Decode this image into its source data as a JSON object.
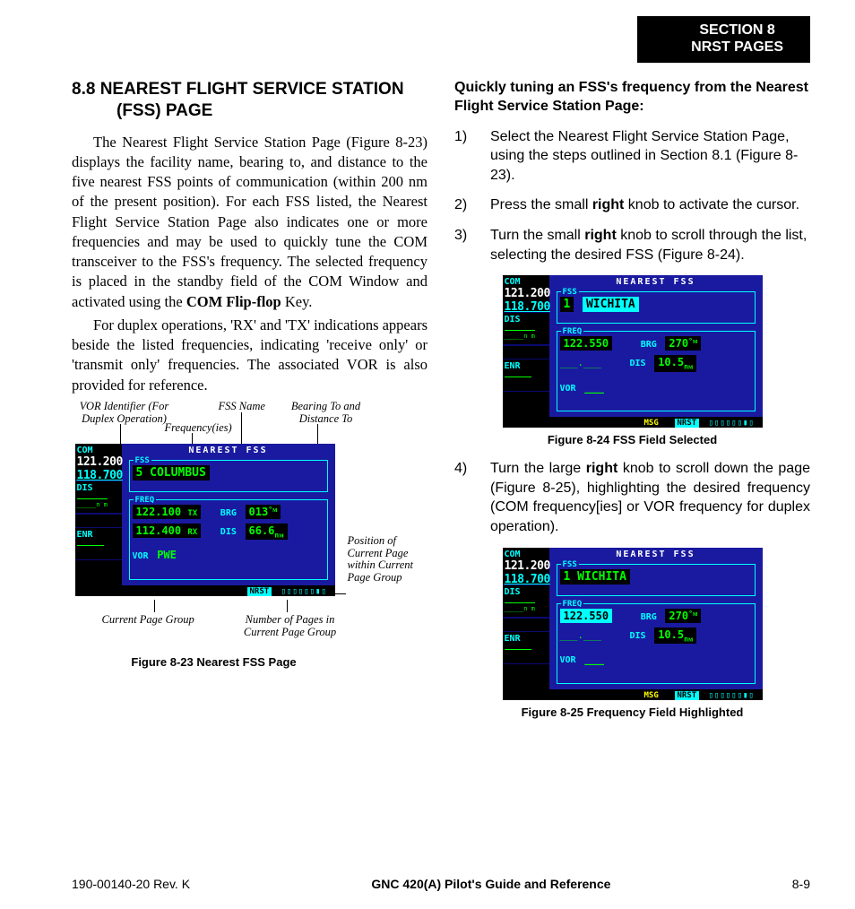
{
  "header": {
    "section_line1": "SECTION 8",
    "section_line2": "NRST PAGES"
  },
  "left_col": {
    "heading_line1": "8.8  NEAREST FLIGHT SERVICE STATION",
    "heading_line2": "(FSS) PAGE",
    "para1": "The Nearest Flight Service Station Page (Figure 8-23) displays the facility name, bearing to, and distance to the five nearest FSS points of communication (within 200 nm of the present position).  For each FSS listed, the Nearest Flight Service Station Page also indicates one or more frequencies and may be used to quickly tune the COM transceiver to the FSS's frequency.  The selected frequency is placed in the standby field of the COM Window and activated using the ",
    "para1_bold": "COM Flip-flop",
    "para1_tail": " Key.",
    "para2": "For duplex operations, 'RX' and 'TX' indications appears beside the listed frequencies, indicating 'receive only' or 'transmit only' frequencies.  The associated VOR is also provided for reference.",
    "annotations": {
      "vor_id": "VOR Identifier (For Duplex Operation)",
      "fss_name": "FSS Name",
      "bearing_dist": "Bearing To and Distance To",
      "frequencies": "Frequency(ies)",
      "page_pos": "Position of Current Page within Current Page Group",
      "curr_group": "Current Page Group",
      "num_pages": "Number of Pages in Current Page Group"
    },
    "fig23_caption": "Figure 8-23  Nearest FSS Page",
    "gps1": {
      "title": "NEAREST FSS",
      "com_lbl": "COM",
      "com_active": "121.200",
      "com_standby": "118.700",
      "dis_lbl": "DIS",
      "dis_under": "____",
      "dis_units": "n m",
      "enr_lbl": "ENR",
      "fss_box_lbl": "FSS",
      "fss_val": "5 COLUMBUS",
      "freq_lbl": "FREQ",
      "freq1": "122.100",
      "freq1_sfx": "TX",
      "freq2": "112.400",
      "freq2_sfx": "RX",
      "vor_lbl": "VOR",
      "vor_val": "PWE",
      "brg_lbl": "BRG",
      "brg_val": "013",
      "brg_unit": "°ᴍ",
      "dis2_lbl": "DIS",
      "dis2_val": "66.6",
      "dis2_unit": "nᴍ",
      "nrst": "NRST"
    }
  },
  "right_col": {
    "subheading": "Quickly tuning an FSS's frequency from the Nearest Flight Service Station Page:",
    "steps_a": [
      {
        "n": "1)",
        "pre": "Select the Nearest Flight Service Station Page, using the steps outlined in Section 8.1 (Figure 8-23)."
      },
      {
        "n": "2)",
        "pre": "Press the small ",
        "bold": "right",
        "post": " knob to activate the cursor."
      },
      {
        "n": "3)",
        "pre": "Turn the small ",
        "bold": "right",
        "post": " knob to scroll through the list, selecting the desired FSS (Figure 8-24)."
      }
    ],
    "fig24_caption": "Figure 8-24  FSS Field Selected",
    "gps2": {
      "title": "NEAREST FSS",
      "com_lbl": "COM",
      "com_active": "121.200",
      "com_standby": "118.700",
      "dis_lbl": "DIS",
      "dis_under": "____",
      "dis_units": "n m",
      "enr_lbl": "ENR",
      "fss_box_lbl": "FSS",
      "fss_num": "1",
      "fss_val": "WICHITA",
      "freq_lbl": "FREQ",
      "freq1": "122.550",
      "vor_lbl": "VOR",
      "vor_val": "___",
      "brg_lbl": "BRG",
      "brg_val": "270",
      "brg_unit": "°ᴍ",
      "dis2_lbl": "DIS",
      "dis2_val": "10.5",
      "dis2_unit": "nᴍ",
      "msg": "MSG",
      "nrst": "NRST"
    },
    "step4": {
      "n": "4)",
      "pre": "Turn the large ",
      "bold": "right",
      "post": " knob to scroll down the page (Figure 8-25), highlighting the desired frequency (COM frequency[ies] or VOR frequency for duplex operation)."
    },
    "fig25_caption": "Figure 8-25  Frequency Field Highlighted",
    "gps3": {
      "title": "NEAREST FSS",
      "com_lbl": "COM",
      "com_active": "121.200",
      "com_standby": "118.700",
      "dis_lbl": "DIS",
      "dis_under": "____",
      "dis_units": "n m",
      "enr_lbl": "ENR",
      "fss_box_lbl": "FSS",
      "fss_val": "1 WICHITA",
      "freq_lbl": "FREQ",
      "freq1": "122.550",
      "vor_lbl": "VOR",
      "vor_val": "___",
      "brg_lbl": "BRG",
      "brg_val": "270",
      "brg_unit": "°ᴍ",
      "dis2_lbl": "DIS",
      "dis2_val": "10.5",
      "dis2_unit": "nᴍ",
      "msg": "MSG",
      "nrst": "NRST"
    }
  },
  "footer": {
    "left": "190-00140-20  Rev. K",
    "center": "GNC 420(A) Pilot's Guide and Reference",
    "right": "8-9"
  }
}
